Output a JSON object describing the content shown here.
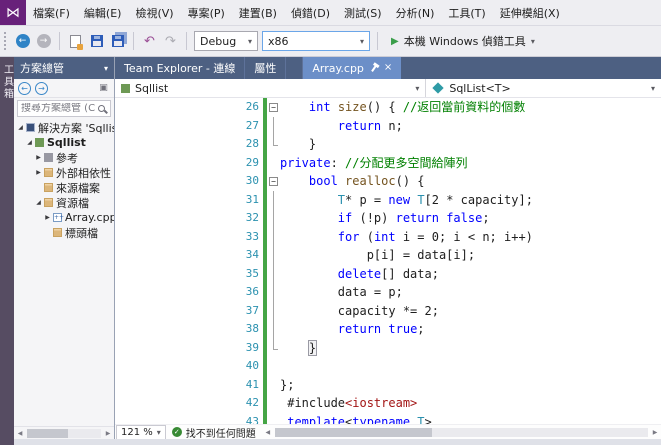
{
  "icons": {
    "logo": "⋈",
    "back": "←",
    "forward": "→",
    "undo": "↶",
    "redo": "↷",
    "run": "▶",
    "dropdown": "▾",
    "close": "×",
    "check": "✓",
    "fold_collapse": "−",
    "tree_collapsed": "▶",
    "tree_expanded": "◢",
    "scroll_left": "◀",
    "scroll_right": "▶"
  },
  "menubar": {
    "items": [
      "檔案(F)",
      "編輯(E)",
      "檢視(V)",
      "專案(P)",
      "建置(B)",
      "偵錯(D)",
      "測試(S)",
      "分析(N)",
      "工具(T)",
      "延伸模組(X)"
    ]
  },
  "toolbar": {
    "config": "Debug",
    "platform": "x86",
    "run_label": "本機 Windows 偵錯工具"
  },
  "toolbox_tab": {
    "label": "工具箱"
  },
  "solution_explorer": {
    "title": "方案總管",
    "search_placeholder": "搜尋方案總管 (Ctrl+;)",
    "toolbar_icons": [
      {
        "id": "se-back",
        "glyph": "←"
      },
      {
        "id": "se-forward",
        "glyph": "→"
      },
      {
        "id": "se-preview",
        "glyph": "▣"
      }
    ],
    "tree": [
      {
        "id": "solution",
        "label": "解決方案 'Sqllist'",
        "icon": "solution",
        "level": 0,
        "expand": "expanded",
        "bold": false
      },
      {
        "id": "project-sqllist",
        "label": "Sqllist",
        "icon": "cpp-project",
        "level": 1,
        "expand": "expanded",
        "bold": true
      },
      {
        "id": "references",
        "label": "參考",
        "icon": "references",
        "level": 2,
        "expand": "collapsed",
        "bold": false
      },
      {
        "id": "external-dependencies",
        "label": "外部相依性",
        "icon": "folder",
        "level": 2,
        "expand": "collapsed",
        "bold": false
      },
      {
        "id": "source-files",
        "label": "來源檔案",
        "icon": "folder",
        "level": 2,
        "expand": "none",
        "bold": false
      },
      {
        "id": "resource-files",
        "label": "資源檔",
        "icon": "folder",
        "level": 2,
        "expand": "expanded",
        "bold": false
      },
      {
        "id": "array-cpp",
        "label": "Array.cpp",
        "icon": "cpp-file",
        "level": 3,
        "expand": "collapsed",
        "bold": false
      },
      {
        "id": "header-files",
        "label": "標頭檔",
        "icon": "folder",
        "level": 3,
        "expand": "none",
        "bold": false
      }
    ]
  },
  "tabs": [
    {
      "id": "team-explorer",
      "label": "Team Explorer - 連線",
      "active": false,
      "gap": false
    },
    {
      "id": "properties",
      "label": "屬性",
      "active": false,
      "gap": false
    },
    {
      "id": "array-cpp",
      "label": "Array.cpp",
      "active": true,
      "gap": true
    }
  ],
  "breadcrumb": {
    "left": "Sqllist",
    "right": "SqlList<T>"
  },
  "editor": {
    "lines": [
      {
        "no": "26",
        "fold": "box",
        "change": true,
        "tokens": [
          {
            "c": "pl",
            "t": "    "
          },
          {
            "c": "kw",
            "t": "int"
          },
          {
            "c": "pl",
            "t": " "
          },
          {
            "c": "fn",
            "t": "size"
          },
          {
            "c": "pl",
            "t": "() { "
          },
          {
            "c": "cm",
            "t": "//返回當前資料的個數"
          }
        ]
      },
      {
        "no": "27",
        "fold": "line",
        "change": true,
        "tokens": [
          {
            "c": "pl",
            "t": "        "
          },
          {
            "c": "kw",
            "t": "return"
          },
          {
            "c": "pl",
            "t": " n;"
          }
        ]
      },
      {
        "no": "28",
        "fold": "end",
        "change": true,
        "tokens": [
          {
            "c": "pl",
            "t": "    }"
          }
        ]
      },
      {
        "no": "29",
        "fold": "",
        "change": true,
        "tokens": [
          {
            "c": "kw",
            "t": "private"
          },
          {
            "c": "pl",
            "t": ": "
          },
          {
            "c": "cm",
            "t": "//分配更多空間給陣列"
          }
        ]
      },
      {
        "no": "30",
        "fold": "box",
        "change": true,
        "tokens": [
          {
            "c": "pl",
            "t": "    "
          },
          {
            "c": "kw",
            "t": "bool"
          },
          {
            "c": "pl",
            "t": " "
          },
          {
            "c": "fn",
            "t": "realloc"
          },
          {
            "c": "pl",
            "t": "() {"
          }
        ]
      },
      {
        "no": "31",
        "fold": "line",
        "change": true,
        "tokens": [
          {
            "c": "pl",
            "t": "        "
          },
          {
            "c": "ty",
            "t": "T"
          },
          {
            "c": "pl",
            "t": "* p = "
          },
          {
            "c": "kw",
            "t": "new"
          },
          {
            "c": "pl",
            "t": " "
          },
          {
            "c": "ty",
            "t": "T"
          },
          {
            "c": "pl",
            "t": "[2 * capacity];"
          }
        ]
      },
      {
        "no": "32",
        "fold": "line",
        "change": true,
        "tokens": [
          {
            "c": "pl",
            "t": "        "
          },
          {
            "c": "kw",
            "t": "if"
          },
          {
            "c": "pl",
            "t": " (!p) "
          },
          {
            "c": "kw",
            "t": "return"
          },
          {
            "c": "pl",
            "t": " "
          },
          {
            "c": "kw",
            "t": "false"
          },
          {
            "c": "pl",
            "t": ";"
          }
        ]
      },
      {
        "no": "33",
        "fold": "line",
        "change": true,
        "tokens": [
          {
            "c": "pl",
            "t": "        "
          },
          {
            "c": "kw",
            "t": "for"
          },
          {
            "c": "pl",
            "t": " ("
          },
          {
            "c": "kw",
            "t": "int"
          },
          {
            "c": "pl",
            "t": " i = 0; i < n; i++)"
          }
        ]
      },
      {
        "no": "34",
        "fold": "line",
        "change": true,
        "tokens": [
          {
            "c": "pl",
            "t": "            p[i] = data[i];"
          }
        ]
      },
      {
        "no": "35",
        "fold": "line",
        "change": true,
        "tokens": [
          {
            "c": "pl",
            "t": "        "
          },
          {
            "c": "kw",
            "t": "delete"
          },
          {
            "c": "pl",
            "t": "[] data;"
          }
        ]
      },
      {
        "no": "36",
        "fold": "line",
        "change": true,
        "tokens": [
          {
            "c": "pl",
            "t": "        data = p;"
          }
        ]
      },
      {
        "no": "37",
        "fold": "line",
        "change": true,
        "tokens": [
          {
            "c": "pl",
            "t": "        capacity *= 2;"
          }
        ]
      },
      {
        "no": "38",
        "fold": "line",
        "change": true,
        "tokens": [
          {
            "c": "pl",
            "t": "        "
          },
          {
            "c": "kw",
            "t": "return"
          },
          {
            "c": "pl",
            "t": " "
          },
          {
            "c": "kw",
            "t": "true"
          },
          {
            "c": "pl",
            "t": ";"
          }
        ]
      },
      {
        "no": "39",
        "fold": "end",
        "change": true,
        "tokens": [
          {
            "c": "pl",
            "t": "    "
          },
          {
            "c": "pl",
            "t": "}",
            "box": true
          }
        ]
      },
      {
        "no": "40",
        "fold": "",
        "change": true,
        "tokens": []
      },
      {
        "no": "41",
        "fold": "",
        "change": true,
        "tokens": [
          {
            "c": "pl",
            "t": "};"
          }
        ]
      },
      {
        "no": "42",
        "fold": "",
        "change": true,
        "tokens": [
          {
            "c": "pl",
            "t": " #include"
          },
          {
            "c": "st",
            "t": "<iostream>"
          }
        ]
      },
      {
        "no": "43",
        "fold": "",
        "change": true,
        "tokens": [
          {
            "c": "pl",
            "t": " "
          },
          {
            "c": "kw",
            "t": "template"
          },
          {
            "c": "pl",
            "t": "<"
          },
          {
            "c": "kw",
            "t": "typename"
          },
          {
            "c": "pl",
            "t": " "
          },
          {
            "c": "ty",
            "t": "T"
          },
          {
            "c": "pl",
            "t": ">"
          }
        ]
      }
    ]
  },
  "statusbar": {
    "zoom": "121 %",
    "health": "找不到任何問題"
  }
}
